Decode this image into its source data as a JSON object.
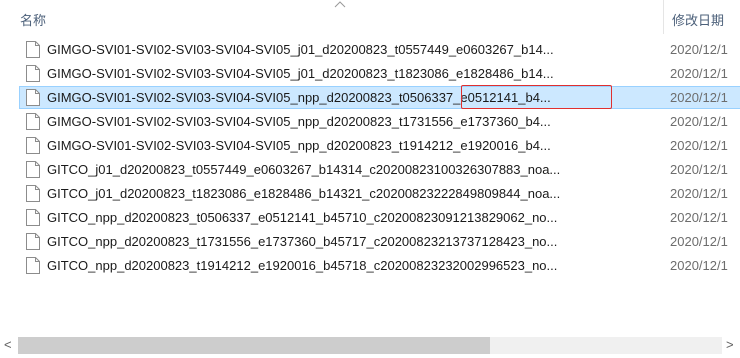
{
  "columns": {
    "name": "名称",
    "date_modified": "修改日期"
  },
  "files": [
    {
      "name": "GIMGO-SVI01-SVI02-SVI03-SVI04-SVI05_j01_d20200823_t0557449_e0603267_b14...",
      "date": "2020/12/1"
    },
    {
      "name": "GIMGO-SVI01-SVI02-SVI03-SVI04-SVI05_j01_d20200823_t1823086_e1828486_b14...",
      "date": "2020/12/1"
    },
    {
      "name": "GIMGO-SVI01-SVI02-SVI03-SVI04-SVI05_npp_d20200823_t0506337_e0512141_b4...",
      "date": "2020/12/1"
    },
    {
      "name": "GIMGO-SVI01-SVI02-SVI03-SVI04-SVI05_npp_d20200823_t1731556_e1737360_b4...",
      "date": "2020/12/1"
    },
    {
      "name": "GIMGO-SVI01-SVI02-SVI03-SVI04-SVI05_npp_d20200823_t1914212_e1920016_b4...",
      "date": "2020/12/1"
    },
    {
      "name": "GITCO_j01_d20200823_t0557449_e0603267_b14314_c20200823100326307883_noa...",
      "date": "2020/12/1"
    },
    {
      "name": "GITCO_j01_d20200823_t1823086_e1828486_b14321_c20200823222849809844_noa...",
      "date": "2020/12/1"
    },
    {
      "name": "GITCO_npp_d20200823_t0506337_e0512141_b45710_c20200823091213829062_no...",
      "date": "2020/12/1"
    },
    {
      "name": "GITCO_npp_d20200823_t1731556_e1737360_b45717_c20200823213737128423_no...",
      "date": "2020/12/1"
    },
    {
      "name": "GITCO_npp_d20200823_t1914212_e1920016_b45718_c20200823232002996523_no...",
      "date": "2020/12/1"
    }
  ],
  "selected_index": 2,
  "scroll": {
    "left_arrow": "<",
    "right_arrow": ">",
    "thumb_fraction": 0.67
  },
  "colors": {
    "selection": "#cce8ff",
    "selection_border": "#99d1ff",
    "annotation": "#e0302f"
  }
}
